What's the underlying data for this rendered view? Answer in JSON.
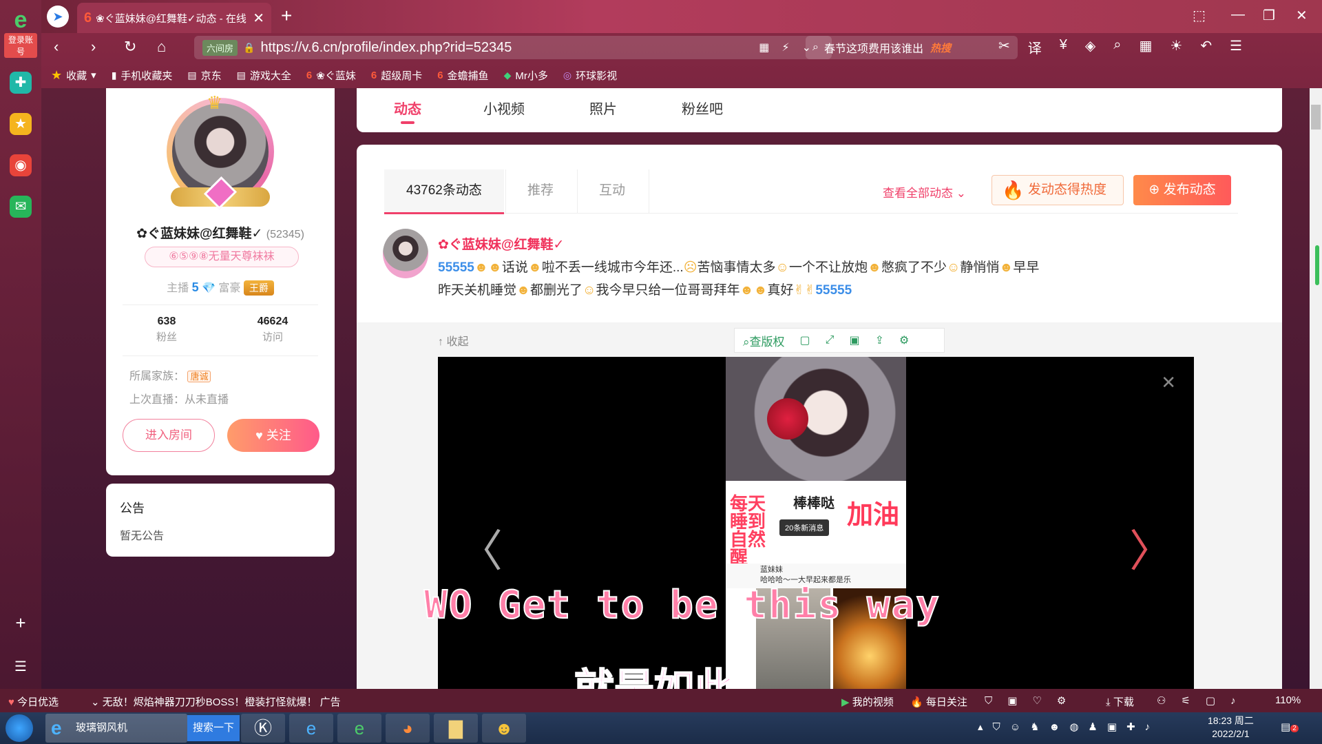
{
  "browser": {
    "left_rail_label": "登录账号",
    "tab_title": "❀ぐ蓝妹妹@红舞鞋✓动态 - 在线",
    "url": "https://v.6.cn/profile/index.php?rid=52345",
    "site_tag": "六间房",
    "search_text": "春节这项费用该谁出",
    "search_hot": "热搜",
    "bookmarks": [
      "收藏",
      "手机收藏夹",
      "京东",
      "游戏大全",
      "❀ぐ蓝妹",
      "超级周卡",
      "金蟾捕鱼",
      "Mr小多",
      "环球影视"
    ]
  },
  "profile": {
    "name": "✿ぐ蓝妹妹@红舞鞋✓",
    "rid": "(52345)",
    "badge": "⑥⑤⑨⑧无量天尊袜袜",
    "host_label": "主播",
    "host_level": "5",
    "rich_label": "富豪",
    "rich_title": "王爵",
    "fans_count": "638",
    "fans_label": "粉丝",
    "visits_count": "46624",
    "visits_label": "访问",
    "family_label": "所属家族：",
    "family_name": "唐诚",
    "last_live": "上次直播：从未直播",
    "enter_room": "进入房间",
    "follow": "关注"
  },
  "notice": {
    "title": "公告",
    "body": "暂无公告"
  },
  "nav": {
    "tabs": [
      "动态",
      "小视频",
      "照片",
      "粉丝吧"
    ],
    "active": 0
  },
  "feed": {
    "tab_count": "43762条动态",
    "tab_recommend": "推荐",
    "tab_interact": "互动",
    "view_all": "查看全部动态",
    "heat_button": "发动态得热度",
    "post_button": "发布动态"
  },
  "post": {
    "author": "✿ぐ蓝妹妹@红舞鞋✓",
    "line1_a": "话说",
    "line1_b": "啦不丢一线城市今年还...",
    "line1_c": "苦恼事情太多",
    "line1_d": "一个不让放炮",
    "line1_e": "憋疯了不少",
    "line1_f": "静悄悄",
    "line1_g": "早早",
    "line2_a": "昨天关机睡觉",
    "line2_b": "都删光了",
    "line2_c": "我今早只给一位哥哥拜年",
    "line2_d": "真好",
    "collapse": "收起",
    "view_source": "查版权"
  },
  "media": {
    "pic_left": "每天睡到自然醒",
    "pic_center": "棒棒哒",
    "pic_right": "加油",
    "pic_messages": "20条新消息",
    "pic_chat_name": "蓝妹妹",
    "pic_chat_text": "哈哈哈～一大早起来都是乐",
    "overlay_en": "WO Get to be this way",
    "overlay_cn": "就是如此"
  },
  "statusbar": {
    "today": "今日优选",
    "ad": "无敌！烬焰神器刀刀秒BOSS！橙装打怪就爆！",
    "ad_tag": "广告",
    "my_video": "我的视频",
    "daily": "每日关注",
    "download": "下载",
    "zoom": "110%"
  },
  "taskbar": {
    "ie_window": "玻璃钢风机",
    "search": "搜索一下",
    "time": "18:23 周二",
    "date": "2022/2/1",
    "badge": "2"
  }
}
